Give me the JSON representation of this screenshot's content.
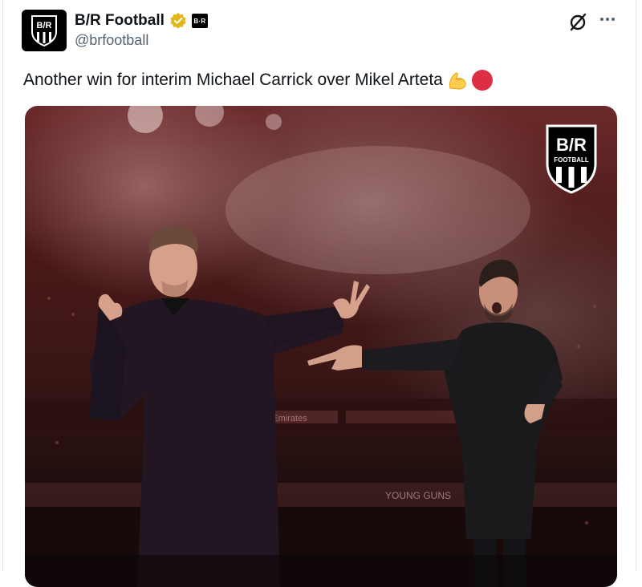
{
  "account": {
    "display_name": "B/R Football",
    "handle": "@brfootball",
    "avatar_text": "B/R",
    "affiliate_badge": "B·R"
  },
  "tweet": {
    "text": "Another win for interim Michael Carrick over Mikel Arteta",
    "emojis": [
      "flexed-biceps",
      "red-circle"
    ]
  },
  "media": {
    "logo_top": "B/R",
    "logo_bottom": "FOOTBALL",
    "stadium_banner_1": "Emirates",
    "stadium_banner_2": "YOUNG GUNS"
  },
  "icons": {
    "verified": "verified-badge-gold",
    "grok": "grok-icon",
    "more": "more-options-icon"
  },
  "colors": {
    "verified_gold": "#e2b719",
    "text_primary": "#0f1419",
    "text_secondary": "#536471",
    "red_circle": "#dd2e44"
  }
}
